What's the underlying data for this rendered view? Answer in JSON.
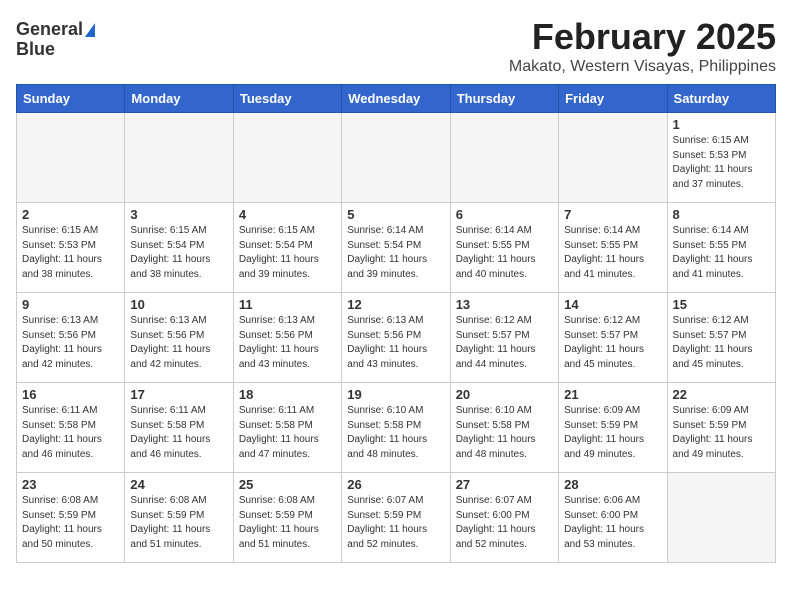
{
  "header": {
    "logo_line1": "General",
    "logo_line2": "Blue",
    "title": "February 2025",
    "subtitle": "Makato, Western Visayas, Philippines"
  },
  "calendar": {
    "days_of_week": [
      "Sunday",
      "Monday",
      "Tuesday",
      "Wednesday",
      "Thursday",
      "Friday",
      "Saturday"
    ],
    "weeks": [
      [
        {
          "day": "",
          "empty": true
        },
        {
          "day": "",
          "empty": true
        },
        {
          "day": "",
          "empty": true
        },
        {
          "day": "",
          "empty": true
        },
        {
          "day": "",
          "empty": true
        },
        {
          "day": "",
          "empty": true
        },
        {
          "day": "1",
          "sunrise": "6:15 AM",
          "sunset": "5:53 PM",
          "daylight": "11 hours and 37 minutes."
        }
      ],
      [
        {
          "day": "2",
          "sunrise": "6:15 AM",
          "sunset": "5:53 PM",
          "daylight": "11 hours and 38 minutes."
        },
        {
          "day": "3",
          "sunrise": "6:15 AM",
          "sunset": "5:54 PM",
          "daylight": "11 hours and 38 minutes."
        },
        {
          "day": "4",
          "sunrise": "6:15 AM",
          "sunset": "5:54 PM",
          "daylight": "11 hours and 39 minutes."
        },
        {
          "day": "5",
          "sunrise": "6:14 AM",
          "sunset": "5:54 PM",
          "daylight": "11 hours and 39 minutes."
        },
        {
          "day": "6",
          "sunrise": "6:14 AM",
          "sunset": "5:55 PM",
          "daylight": "11 hours and 40 minutes."
        },
        {
          "day": "7",
          "sunrise": "6:14 AM",
          "sunset": "5:55 PM",
          "daylight": "11 hours and 41 minutes."
        },
        {
          "day": "8",
          "sunrise": "6:14 AM",
          "sunset": "5:55 PM",
          "daylight": "11 hours and 41 minutes."
        }
      ],
      [
        {
          "day": "9",
          "sunrise": "6:13 AM",
          "sunset": "5:56 PM",
          "daylight": "11 hours and 42 minutes."
        },
        {
          "day": "10",
          "sunrise": "6:13 AM",
          "sunset": "5:56 PM",
          "daylight": "11 hours and 42 minutes."
        },
        {
          "day": "11",
          "sunrise": "6:13 AM",
          "sunset": "5:56 PM",
          "daylight": "11 hours and 43 minutes."
        },
        {
          "day": "12",
          "sunrise": "6:13 AM",
          "sunset": "5:56 PM",
          "daylight": "11 hours and 43 minutes."
        },
        {
          "day": "13",
          "sunrise": "6:12 AM",
          "sunset": "5:57 PM",
          "daylight": "11 hours and 44 minutes."
        },
        {
          "day": "14",
          "sunrise": "6:12 AM",
          "sunset": "5:57 PM",
          "daylight": "11 hours and 45 minutes."
        },
        {
          "day": "15",
          "sunrise": "6:12 AM",
          "sunset": "5:57 PM",
          "daylight": "11 hours and 45 minutes."
        }
      ],
      [
        {
          "day": "16",
          "sunrise": "6:11 AM",
          "sunset": "5:58 PM",
          "daylight": "11 hours and 46 minutes."
        },
        {
          "day": "17",
          "sunrise": "6:11 AM",
          "sunset": "5:58 PM",
          "daylight": "11 hours and 46 minutes."
        },
        {
          "day": "18",
          "sunrise": "6:11 AM",
          "sunset": "5:58 PM",
          "daylight": "11 hours and 47 minutes."
        },
        {
          "day": "19",
          "sunrise": "6:10 AM",
          "sunset": "5:58 PM",
          "daylight": "11 hours and 48 minutes."
        },
        {
          "day": "20",
          "sunrise": "6:10 AM",
          "sunset": "5:58 PM",
          "daylight": "11 hours and 48 minutes."
        },
        {
          "day": "21",
          "sunrise": "6:09 AM",
          "sunset": "5:59 PM",
          "daylight": "11 hours and 49 minutes."
        },
        {
          "day": "22",
          "sunrise": "6:09 AM",
          "sunset": "5:59 PM",
          "daylight": "11 hours and 49 minutes."
        }
      ],
      [
        {
          "day": "23",
          "sunrise": "6:08 AM",
          "sunset": "5:59 PM",
          "daylight": "11 hours and 50 minutes."
        },
        {
          "day": "24",
          "sunrise": "6:08 AM",
          "sunset": "5:59 PM",
          "daylight": "11 hours and 51 minutes."
        },
        {
          "day": "25",
          "sunrise": "6:08 AM",
          "sunset": "5:59 PM",
          "daylight": "11 hours and 51 minutes."
        },
        {
          "day": "26",
          "sunrise": "6:07 AM",
          "sunset": "5:59 PM",
          "daylight": "11 hours and 52 minutes."
        },
        {
          "day": "27",
          "sunrise": "6:07 AM",
          "sunset": "6:00 PM",
          "daylight": "11 hours and 52 minutes."
        },
        {
          "day": "28",
          "sunrise": "6:06 AM",
          "sunset": "6:00 PM",
          "daylight": "11 hours and 53 minutes."
        },
        {
          "day": "",
          "empty": true
        }
      ]
    ]
  }
}
